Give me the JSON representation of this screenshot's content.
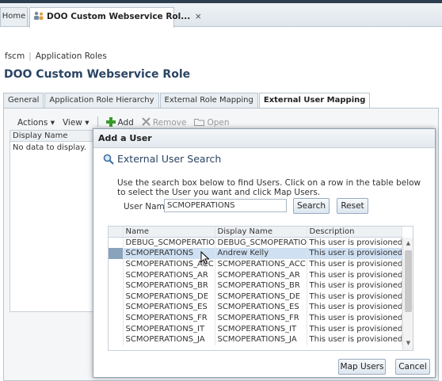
{
  "tabs": {
    "home": "Home",
    "active": "DOO Custom Webservice Rol...",
    "close": "×"
  },
  "breadcrumb": {
    "first": "fscm",
    "second": "Application Roles"
  },
  "page_title": "DOO Custom Webservice Role",
  "subtabs": [
    "General",
    "Application Role Hierarchy",
    "External Role Mapping",
    "External User Mapping"
  ],
  "toolbar": {
    "actions": "Actions ▾",
    "view": "View ▾",
    "add": "Add",
    "remove": "Remove",
    "open": "Open"
  },
  "bg_table": {
    "header": "Display Name",
    "empty": "No data to display."
  },
  "dialog": {
    "title": "Add a User",
    "search_title": "External User Search",
    "instructions": "Use the search box below to find Users. Click on a row in the table below to select the User you want and click Map Users.",
    "user_name_label": "User Name",
    "user_name_value": "SCMOPERATIONS",
    "search_button": "Search",
    "reset_button": "Reset",
    "map_button": "Map Users",
    "cancel_button": "Cancel",
    "columns": [
      "Name",
      "Display Name",
      "Description"
    ],
    "rows": [
      [
        "DEBUG_SCMOPERATIONS",
        "DEBUG_SCMOPERATIONS",
        "This user is provisioned \"..."
      ],
      [
        "SCMOPERATIONS",
        "Andrew Kelly",
        "This user is provisioned \"..."
      ],
      [
        "SCMOPERATIONS_ACC",
        "SCMOPERATIONS_ACC",
        "This user is provisioned \"..."
      ],
      [
        "SCMOPERATIONS_AR",
        "SCMOPERATIONS_AR",
        "This user is provisioned \"..."
      ],
      [
        "SCMOPERATIONS_BR",
        "SCMOPERATIONS_BR",
        "This user is provisioned \"..."
      ],
      [
        "SCMOPERATIONS_DE",
        "SCMOPERATIONS_DE",
        "This user is provisioned \"..."
      ],
      [
        "SCMOPERATIONS_ES",
        "SCMOPERATIONS_ES",
        "This user is provisioned \"..."
      ],
      [
        "SCMOPERATIONS_FR",
        "SCMOPERATIONS_FR",
        "This user is provisioned \"..."
      ],
      [
        "SCMOPERATIONS_IT",
        "SCMOPERATIONS_IT",
        "This user is provisioned \"..."
      ],
      [
        "SCMOPERATIONS_JA",
        "SCMOPERATIONS_JA",
        "This user is provisioned \"..."
      ]
    ]
  },
  "colors": {
    "title": "#2b4463",
    "selection": "#cfe0f2",
    "add_green": "#3a9a2c"
  }
}
